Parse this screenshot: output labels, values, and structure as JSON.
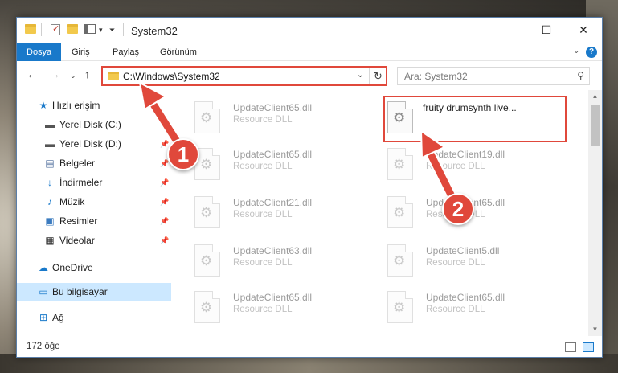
{
  "window": {
    "title": "System32",
    "controls": {
      "minimize": "—",
      "maximize": "☐",
      "close": "✕"
    }
  },
  "ribbon": {
    "tabs": [
      {
        "label": "Dosya",
        "active": true
      },
      {
        "label": "Giriş"
      },
      {
        "label": "Paylaş"
      },
      {
        "label": "Görünüm"
      }
    ],
    "help": "?"
  },
  "navigation": {
    "address": "C:\\Windows\\System32",
    "search_placeholder": "Ara: System32"
  },
  "sidebar": {
    "items": [
      {
        "label": "Hızlı erişim",
        "icon": "star-icon",
        "pinned": false
      },
      {
        "label": "Yerel Disk (C:)",
        "icon": "drive-icon",
        "pinned": false
      },
      {
        "label": "Yerel Disk (D:)",
        "icon": "drive-icon",
        "pinned": true
      },
      {
        "label": "Belgeler",
        "icon": "documents-icon",
        "pinned": true
      },
      {
        "label": "İndirmeler",
        "icon": "downloads-icon",
        "pinned": true
      },
      {
        "label": "Müzik",
        "icon": "music-icon",
        "pinned": true
      },
      {
        "label": "Resimler",
        "icon": "pictures-icon",
        "pinned": true
      },
      {
        "label": "Videolar",
        "icon": "videos-icon",
        "pinned": true
      },
      {
        "label": "OneDrive",
        "icon": "cloud-icon",
        "pinned": false
      },
      {
        "label": "Bu bilgisayar",
        "icon": "computer-icon",
        "pinned": false,
        "selected": true
      },
      {
        "label": "Ağ",
        "icon": "network-icon",
        "pinned": false
      }
    ]
  },
  "files": [
    {
      "name": "UpdateClient65.dll",
      "type": "Resource DLL"
    },
    {
      "name": "fruity drumsynth live...",
      "type": "",
      "selected": true
    },
    {
      "name": "UpdateClient65.dll",
      "type": "Resource DLL"
    },
    {
      "name": "UpdateClient19.dll",
      "type": "Resource DLL"
    },
    {
      "name": "UpdateClient21.dll",
      "type": "Resource DLL"
    },
    {
      "name": "UpdateClient65.dll",
      "type": "Resource DLL"
    },
    {
      "name": "UpdateClient63.dll",
      "type": "Resource DLL"
    },
    {
      "name": "UpdateClient5.dll",
      "type": "Resource DLL"
    },
    {
      "name": "UpdateClient65.dll",
      "type": "Resource DLL"
    },
    {
      "name": "UpdateClient65.dll",
      "type": "Resource DLL"
    }
  ],
  "status": {
    "item_count": "172 öğe"
  },
  "annotations": {
    "step1": "1",
    "step2": "2",
    "color": "#e0483b"
  }
}
